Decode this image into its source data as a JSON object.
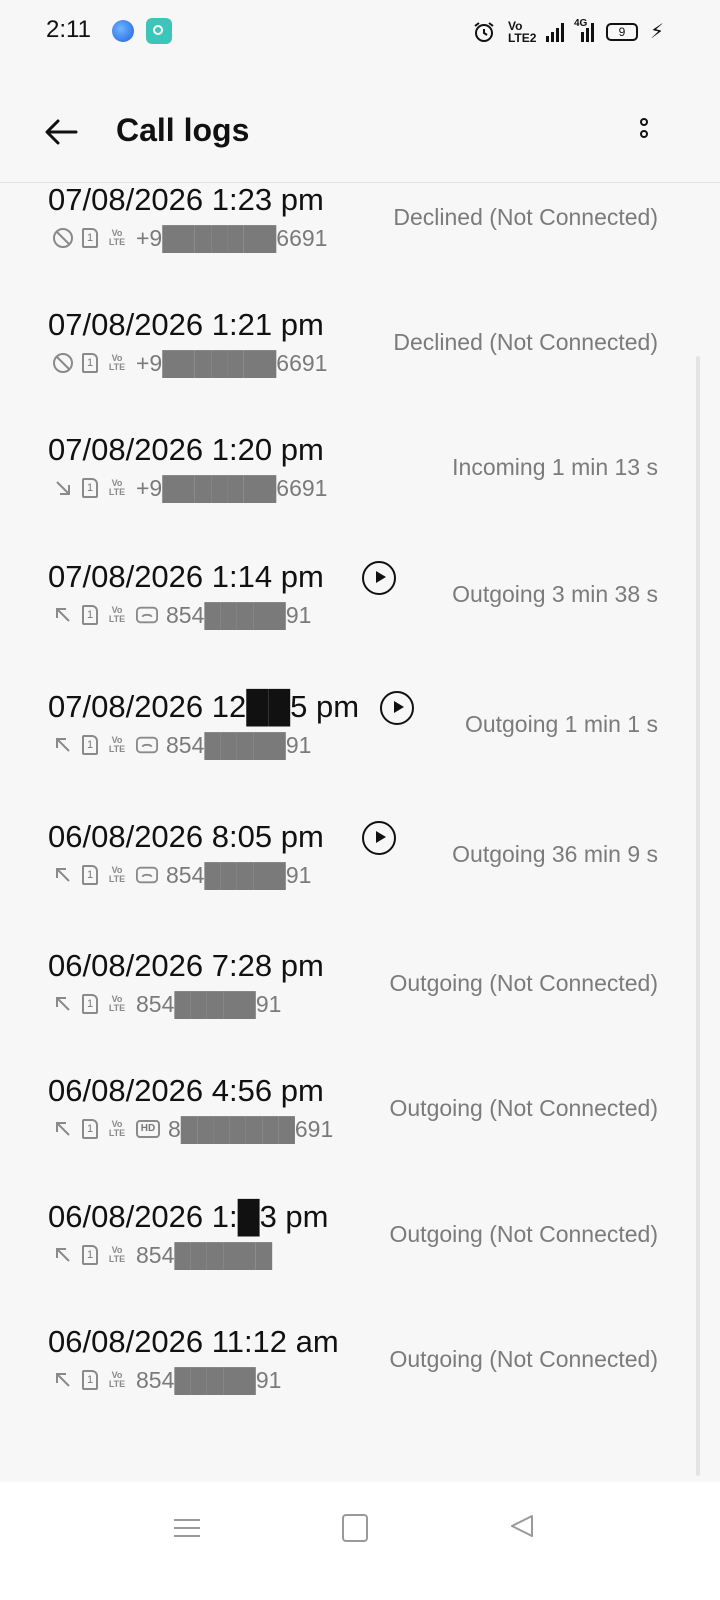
{
  "status_bar": {
    "time": "2:11",
    "volte_label": "Vo LTE2",
    "network_label": "4G",
    "battery": "9",
    "icons": [
      "alarm-icon",
      "volte-icon",
      "signal-icon",
      "4g-signal-icon",
      "battery-icon",
      "charging-icon"
    ]
  },
  "header": {
    "title": "Call logs",
    "back_icon": "back-arrow-icon",
    "more_icon": "more-vertical-icon"
  },
  "calls": [
    {
      "datetime": "07/08/2026 1:23 pm",
      "direction_icon": "blocked-icon",
      "sim": "1",
      "extra_icon": "",
      "number": "+9███████6691",
      "status": "Declined (Not Connected)",
      "has_recording": false
    },
    {
      "datetime": "07/08/2026 1:21 pm",
      "direction_icon": "blocked-icon",
      "sim": "1",
      "extra_icon": "",
      "number": "+9███████6691",
      "status": "Declined (Not Connected)",
      "has_recording": false
    },
    {
      "datetime": "07/08/2026 1:20 pm",
      "direction_icon": "incoming-arrow-icon",
      "sim": "1",
      "extra_icon": "",
      "number": "+9███████6691",
      "status": "Incoming  1 min 13 s",
      "has_recording": false
    },
    {
      "datetime": "07/08/2026 1:14 pm",
      "direction_icon": "outgoing-arrow-icon",
      "sim": "1",
      "extra_icon": "call-recorder-icon",
      "number": "854█████91",
      "status": "Outgoing  3 min 38 s",
      "has_recording": true
    },
    {
      "datetime": "07/08/2026 12██5 pm",
      "direction_icon": "outgoing-arrow-icon",
      "sim": "1",
      "extra_icon": "call-recorder-icon",
      "number": "854█████91",
      "status": "Outgoing  1 min 1 s",
      "has_recording": true
    },
    {
      "datetime": "06/08/2026 8:05 pm",
      "direction_icon": "outgoing-arrow-icon",
      "sim": "1",
      "extra_icon": "call-recorder-icon",
      "number": "854█████91",
      "status": "Outgoing  36 min 9 s",
      "has_recording": true
    },
    {
      "datetime": "06/08/2026 7:28 pm",
      "direction_icon": "outgoing-arrow-icon",
      "sim": "1",
      "extra_icon": "",
      "number": "854█████91",
      "status": "Outgoing (Not Connected)",
      "has_recording": false
    },
    {
      "datetime": "06/08/2026 4:56 pm",
      "direction_icon": "outgoing-arrow-icon",
      "sim": "1",
      "extra_icon": "hd-icon",
      "number": "8███████691",
      "status": "Outgoing (Not Connected)",
      "has_recording": false
    },
    {
      "datetime": "06/08/2026 1:█3 pm",
      "direction_icon": "outgoing-arrow-icon",
      "sim": "1",
      "extra_icon": "",
      "number": "854██████",
      "status": "Outgoing (Not Connected)",
      "has_recording": false
    },
    {
      "datetime": "06/08/2026 11:12 am",
      "direction_icon": "outgoing-arrow-icon",
      "sim": "1",
      "extra_icon": "",
      "number": "854█████91",
      "status": "Outgoing (Not Connected)",
      "has_recording": false
    }
  ],
  "volte_label": "Vo LTE",
  "hd_label": "HD",
  "nav_bar": {
    "icons": [
      "menu-icon",
      "home-icon",
      "back-icon"
    ]
  }
}
